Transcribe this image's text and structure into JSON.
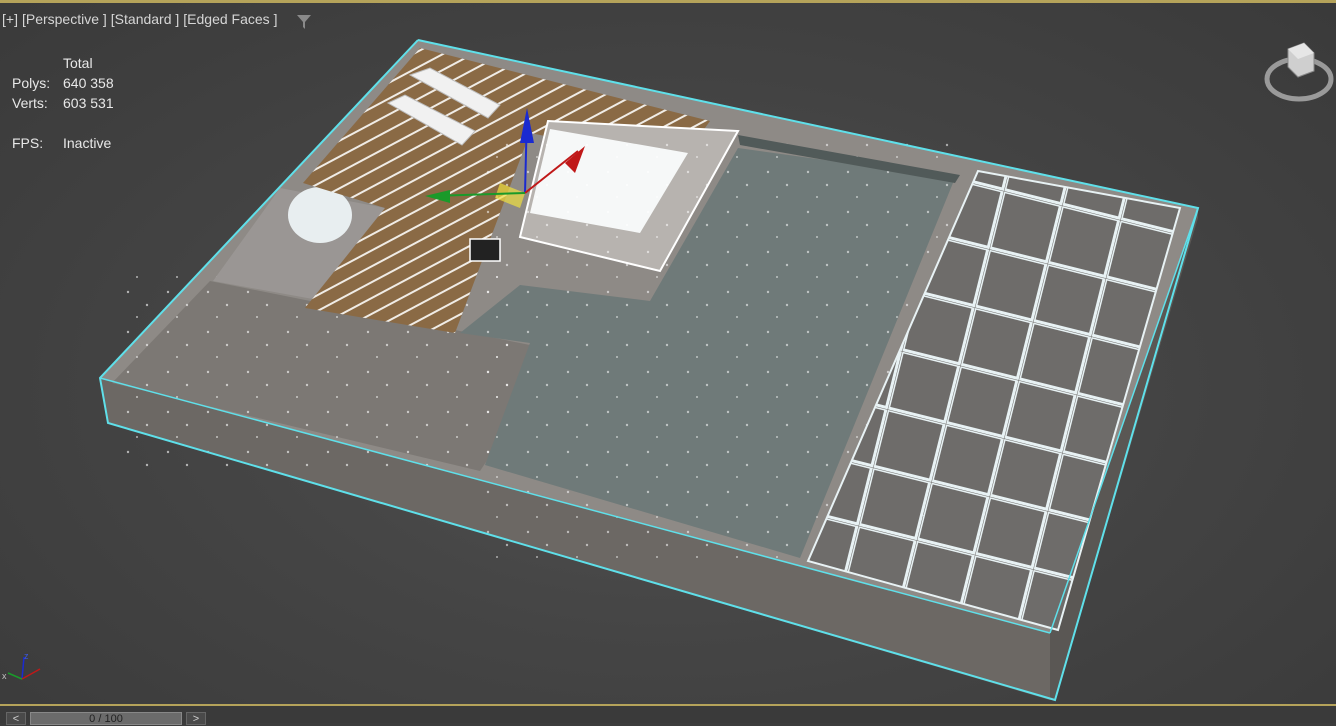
{
  "viewport": {
    "labels": [
      "[+]",
      "[Perspective ]",
      "[Standard ]",
      "[Edged Faces ]"
    ],
    "filter_icon": "funnel-icon",
    "active_border_color": "#b5a35a"
  },
  "stats": {
    "header": "Total",
    "polys_label": "Polys:",
    "polys_value": "640 358",
    "verts_label": "Verts:",
    "verts_value": "603 531",
    "fps_label": "FPS:",
    "fps_value": "Inactive"
  },
  "scene": {
    "selection_color": "#5fe0ea",
    "gizmo_colors": {
      "x": "#c01818",
      "y": "#1a9a2a",
      "z": "#1a2ad0"
    },
    "viewcube_icon": "viewcube-icon",
    "axis_tripod_icon": "axis-tripod-icon",
    "tripod_labels": {
      "x": "x",
      "z": "z"
    }
  },
  "timeline": {
    "prev_label": "<",
    "next_label": ">",
    "frame_text": "0 / 100"
  }
}
